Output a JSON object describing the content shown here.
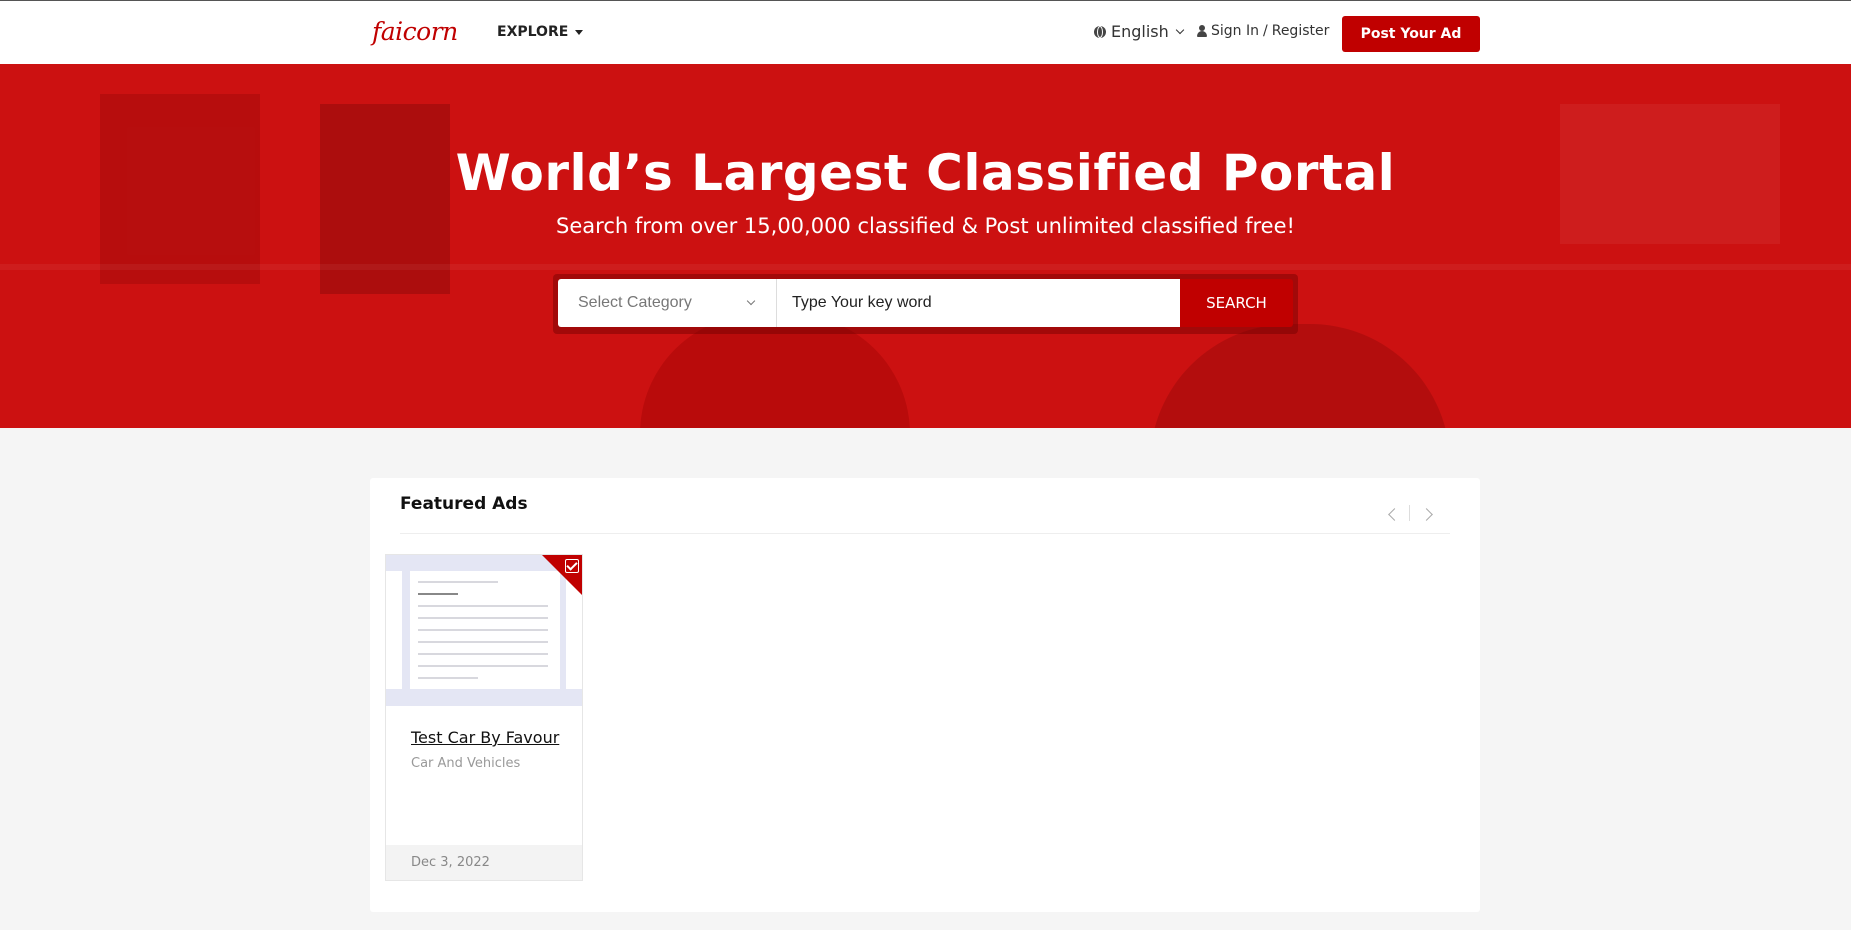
{
  "header": {
    "logo": "faicorn",
    "explore_label": "EXPLORE",
    "language": "English",
    "sign_in": "Sign In",
    "separator": "/",
    "register": "Register",
    "post_ad_label": "Post Your Ad"
  },
  "hero": {
    "title": "World’s Largest Classified Portal",
    "subtitle": "Search from over 15,00,000 classified & Post unlimited classified free!",
    "category_select": "Select Category",
    "keyword_placeholder": "Type Your key word",
    "search_label": "SEARCH",
    "bg_color": "#cc1111"
  },
  "featured": {
    "heading": "Featured Ads",
    "ads": [
      {
        "title": "Test Car By Favour",
        "category": "Car And Vehicles",
        "date": "Dec 3, 2022",
        "badge_icon": "check-square-icon"
      }
    ]
  },
  "colors": {
    "brand": "#c00000",
    "page_bg": "#f5f5f5"
  }
}
